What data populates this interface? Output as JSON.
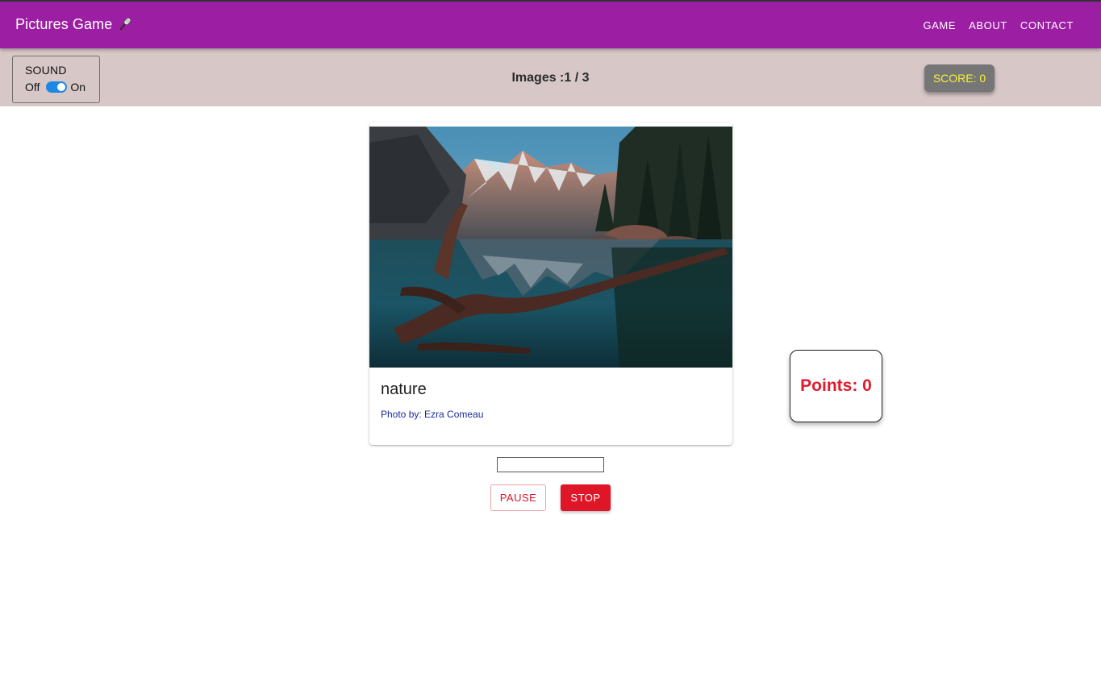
{
  "appbar": {
    "title": "Pictures Game",
    "title_icon": "microphone-icon",
    "background": "#9c1ea3",
    "nav": [
      {
        "label": "GAME"
      },
      {
        "label": "ABOUT"
      },
      {
        "label": "CONTACT"
      }
    ]
  },
  "toolbar": {
    "sound": {
      "title": "SOUND",
      "off_label": "Off",
      "on_label": "On",
      "enabled": true,
      "toggle_color": "#1e88e5"
    },
    "images_count": "Images :1 / 3",
    "score_label": "SCORE: 0",
    "background": "#d7c7c7"
  },
  "card": {
    "image_description": "mountain-lake-photo",
    "title": "nature",
    "credit": "Photo by: Ezra Comeau"
  },
  "answer": {
    "value": "",
    "placeholder": ""
  },
  "buttons": {
    "pause_label": "PAUSE",
    "stop_label": "STOP",
    "accent": "#df1628"
  },
  "points": {
    "label": "Points: 0",
    "color": "#e21a2c"
  }
}
